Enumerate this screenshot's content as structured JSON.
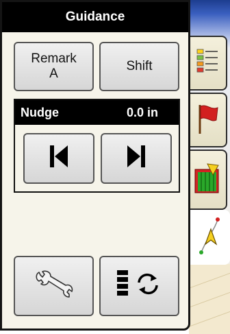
{
  "panel": {
    "title": "Guidance"
  },
  "buttons": {
    "remark_line1": "Remark",
    "remark_line2": "A",
    "shift": "Shift"
  },
  "nudge": {
    "label": "Nudge",
    "value": "0.0 in"
  },
  "icons": {
    "nudge_left": "skip-back-icon",
    "nudge_right": "skip-forward-icon",
    "settings": "wrench-icon",
    "cycle_view": "bars-rotate-icon",
    "tab_list": "color-list-icon",
    "tab_flag": "red-flag-icon",
    "tab_field": "green-field-icon",
    "tab_guidance": "guidance-path-icon"
  },
  "colors": {
    "accent_red": "#d22020",
    "accent_green": "#2aa82a",
    "header_bg": "#000000"
  }
}
